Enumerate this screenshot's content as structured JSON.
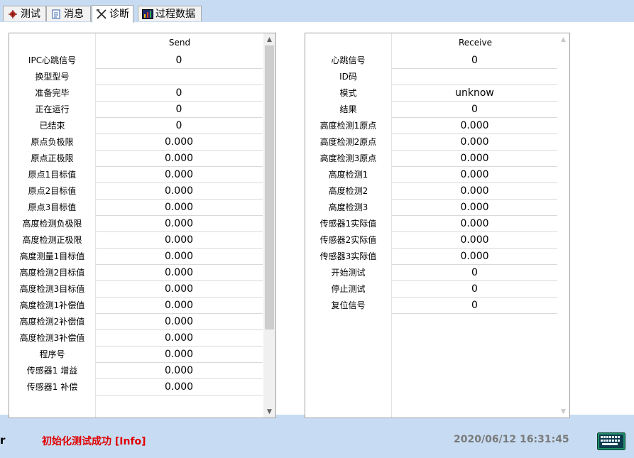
{
  "tabs": [
    {
      "label": "测试",
      "icon": "test-icon"
    },
    {
      "label": "消息",
      "icon": "message-icon"
    },
    {
      "label": "诊断",
      "icon": "diagnosis-tools-icon"
    },
    {
      "label": "过程数据",
      "icon": "process-data-icon"
    }
  ],
  "active_tab": "诊断",
  "send": {
    "header": "Send",
    "rows": [
      {
        "label": "IPC心跳信号",
        "value": "0"
      },
      {
        "label": "换型型号",
        "value": ""
      },
      {
        "label": "准备完毕",
        "value": "0"
      },
      {
        "label": "正在运行",
        "value": "0"
      },
      {
        "label": "已结束",
        "value": "0"
      },
      {
        "label": "原点负极限",
        "value": "0.000"
      },
      {
        "label": "原点正极限",
        "value": "0.000"
      },
      {
        "label": "原点1目标值",
        "value": "0.000"
      },
      {
        "label": "原点2目标值",
        "value": "0.000"
      },
      {
        "label": "原点3目标值",
        "value": "0.000"
      },
      {
        "label": "高度检测负极限",
        "value": "0.000"
      },
      {
        "label": "高度检测正极限",
        "value": "0.000"
      },
      {
        "label": "高度测量1目标值",
        "value": "0.000"
      },
      {
        "label": "高度检测2目标值",
        "value": "0.000"
      },
      {
        "label": "高度检测3目标值",
        "value": "0.000"
      },
      {
        "label": "高度检测1补偿值",
        "value": "0.000"
      },
      {
        "label": "高度检测2补偿值",
        "value": "0.000"
      },
      {
        "label": "高度检测3补偿值",
        "value": "0.000"
      },
      {
        "label": "程序号",
        "value": "0.000"
      },
      {
        "label": "传感器1 增益",
        "value": "0.000"
      },
      {
        "label": "传感器1 补偿",
        "value": "0.000"
      }
    ]
  },
  "receive": {
    "header": "Receive",
    "rows": [
      {
        "label": "心跳信号",
        "value": "0"
      },
      {
        "label": "ID码",
        "value": ""
      },
      {
        "label": "模式",
        "value": "unknow"
      },
      {
        "label": "结果",
        "value": "0"
      },
      {
        "label": "高度检测1原点",
        "value": "0.000"
      },
      {
        "label": "高度检测2原点",
        "value": "0.000"
      },
      {
        "label": "高度检测3原点",
        "value": "0.000"
      },
      {
        "label": "高度检测1",
        "value": "0.000"
      },
      {
        "label": "高度检测2",
        "value": "0.000"
      },
      {
        "label": "高度检测3",
        "value": "0.000"
      },
      {
        "label": "传感器1实际值",
        "value": "0.000"
      },
      {
        "label": "传感器2实际值",
        "value": "0.000"
      },
      {
        "label": "传感器3实际值",
        "value": "0.000"
      },
      {
        "label": "开始测试",
        "value": "0"
      },
      {
        "label": "停止测试",
        "value": "0"
      },
      {
        "label": "复位信号",
        "value": "0"
      }
    ]
  },
  "status": {
    "left_text": "r",
    "message": "初始化测试成功 [Info]",
    "datetime": "2020/06/12 16:31:45",
    "keyboard_icon": "keyboard-icon"
  },
  "colors": {
    "background": "#c7dcf3",
    "status_message": "#e00000",
    "status_time": "#7a7a7a"
  }
}
